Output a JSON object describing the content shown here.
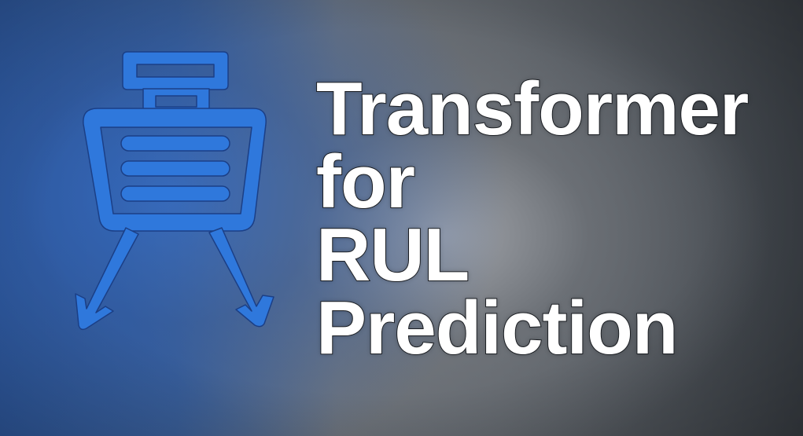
{
  "title": {
    "lines": [
      "Transformer",
      "for",
      "RUL",
      "Prediction"
    ]
  },
  "logo": {
    "icon": "transformer-icon",
    "color": "#2f78dc",
    "outline": "#1b3f86"
  },
  "colors": {
    "title_text": "#ffffff",
    "title_outline": "#1c1f24"
  }
}
